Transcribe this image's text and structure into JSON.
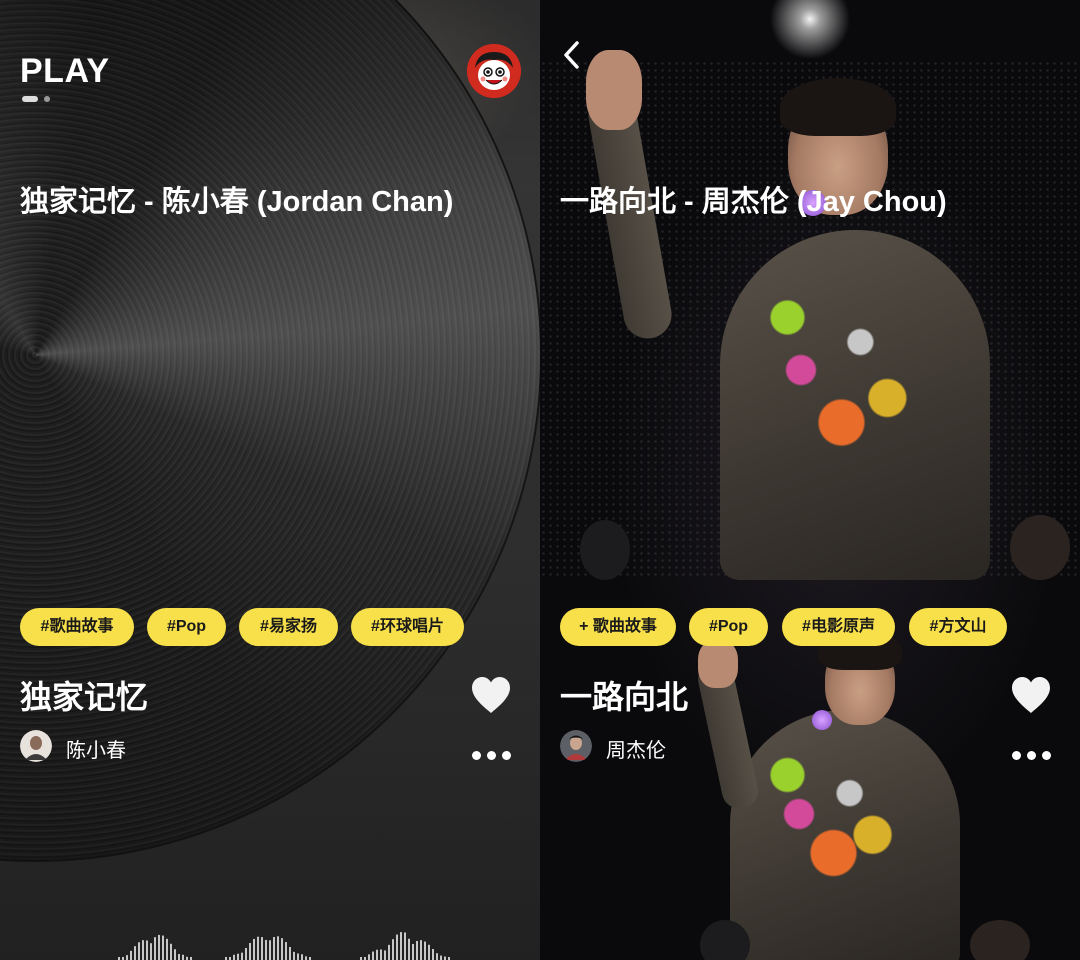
{
  "left": {
    "logo": "PLAY",
    "title": "独家记忆 - 陈小春 (Jordan Chan)",
    "tags": [
      "#歌曲故事",
      "#Pop",
      "#易家扬",
      "#环球唱片"
    ],
    "song_name": "独家记忆",
    "artist_name": "陈小春",
    "icons": {
      "profile": "cartoon-avatar-icon",
      "like": "heart-icon",
      "more": "more-dots-icon",
      "wave": "audio-waveform-icon"
    }
  },
  "right": {
    "title": "一路向北 - 周杰伦 (Jay Chou)",
    "tags": [
      "+ 歌曲故事",
      "#Pop",
      "#电影原声",
      "#方文山"
    ],
    "song_name": "一路向北",
    "artist_name": "周杰伦",
    "icons": {
      "back": "chevron-left-icon",
      "like": "heart-icon",
      "more": "more-dots-icon"
    }
  },
  "colors": {
    "tag_bg": "#f7e04a",
    "tag_text": "#1a1a1a",
    "text": "#ffffff"
  }
}
